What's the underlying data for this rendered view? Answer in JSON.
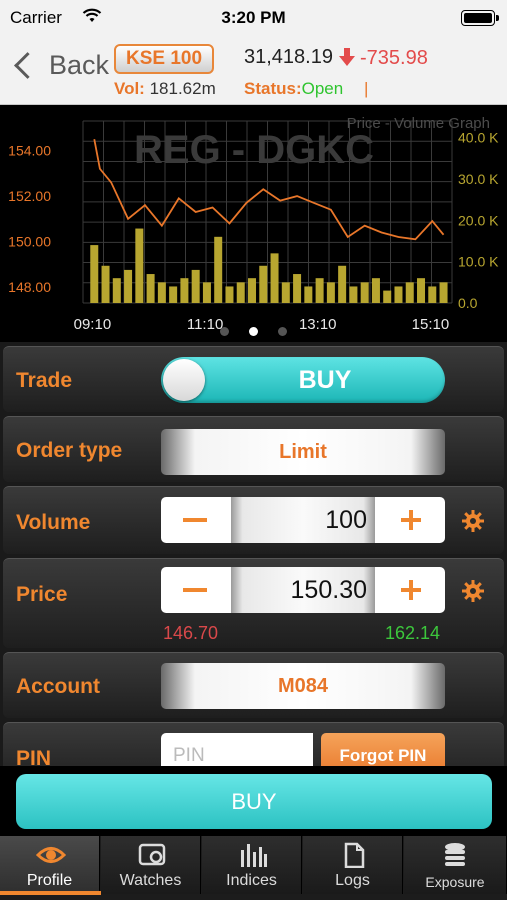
{
  "status_bar": {
    "carrier": "Carrier",
    "time": "3:20 PM"
  },
  "header": {
    "back_label": "Back",
    "index_name": "KSE 100",
    "index_value": "31,418.19",
    "index_change": "-735.98",
    "vol_label": "Vol:",
    "vol_value": "181.62m",
    "status_label": "Status:",
    "status_value": "Open",
    "status_pipe": "|"
  },
  "chart_data": {
    "type": "line",
    "title": "Price - Volume Graph",
    "watermark": "REG - DGKC",
    "x_ticks": [
      "09:10",
      "11:10",
      "13:10",
      "15:10"
    ],
    "y_left_ticks": [
      "154.00",
      "152.00",
      "150.00",
      "148.00"
    ],
    "y_right_ticks": [
      "40.0 K",
      "30.0 K",
      "20.0 K",
      "10.0 K",
      "0.0"
    ],
    "ylim_price": [
      147.3,
      155.3
    ],
    "ylim_volume": [
      0,
      44000
    ],
    "price_series": {
      "name": "Price",
      "color": "#e8762a",
      "x": [
        9.2,
        9.3,
        9.5,
        9.8,
        10.1,
        10.4,
        10.7,
        11.0,
        11.3,
        11.6,
        11.9,
        12.2,
        12.5,
        12.8,
        13.1,
        13.4,
        13.7,
        14.0,
        14.3,
        14.6,
        14.9,
        15.2,
        15.4
      ],
      "y": [
        154.5,
        153.2,
        152.6,
        151.0,
        151.6,
        150.7,
        151.9,
        151.3,
        151.5,
        150.8,
        151.7,
        152.3,
        151.8,
        152.0,
        151.7,
        151.4,
        150.2,
        150.7,
        150.4,
        150.2,
        150.1,
        150.9,
        150.3
      ]
    },
    "volume_series": {
      "name": "Volume",
      "color": "#b8a630",
      "x": [
        9.2,
        9.4,
        9.6,
        9.8,
        10.0,
        10.2,
        10.4,
        10.6,
        10.8,
        11.0,
        11.2,
        11.4,
        11.6,
        11.8,
        12.0,
        12.2,
        12.4,
        12.6,
        12.8,
        13.0,
        13.2,
        13.4,
        13.6,
        13.8,
        14.0,
        14.2,
        14.4,
        14.6,
        14.8,
        15.0,
        15.2,
        15.4
      ],
      "y": [
        14000,
        9000,
        6000,
        8000,
        18000,
        7000,
        5000,
        4000,
        6000,
        8000,
        5000,
        16000,
        4000,
        5000,
        6000,
        9000,
        12000,
        5000,
        7000,
        4000,
        6000,
        5000,
        9000,
        4000,
        5000,
        6000,
        3000,
        4000,
        5000,
        6000,
        4000,
        5000
      ]
    }
  },
  "pager": {
    "pages": 3,
    "active": 1
  },
  "form": {
    "trade": {
      "label": "Trade",
      "value": "BUY"
    },
    "order_type": {
      "label": "Order type",
      "value": "Limit"
    },
    "volume": {
      "label": "Volume",
      "value": "100"
    },
    "price": {
      "label": "Price",
      "value": "150.30",
      "lower_limit": "146.70",
      "upper_limit": "162.14"
    },
    "account": {
      "label": "Account",
      "value": "M084"
    },
    "pin": {
      "label": "PIN",
      "placeholder": "PIN",
      "forgot_label": "Forgot PIN"
    }
  },
  "buy_button": "BUY",
  "tabs": [
    {
      "label": "Profile",
      "icon": "eye-icon",
      "active": true
    },
    {
      "label": "Watches",
      "icon": "watch-card-icon",
      "active": false
    },
    {
      "label": "Indices",
      "icon": "bar-chart-icon",
      "active": false
    },
    {
      "label": "Logs",
      "icon": "document-icon",
      "active": false
    },
    {
      "label": "Exposure",
      "icon": "coins-stack-icon",
      "active": false
    }
  ],
  "colors": {
    "accent": "#f0872f",
    "teal": "#2cc2c2",
    "down": "#e34b4b",
    "up": "#3cc73c"
  }
}
